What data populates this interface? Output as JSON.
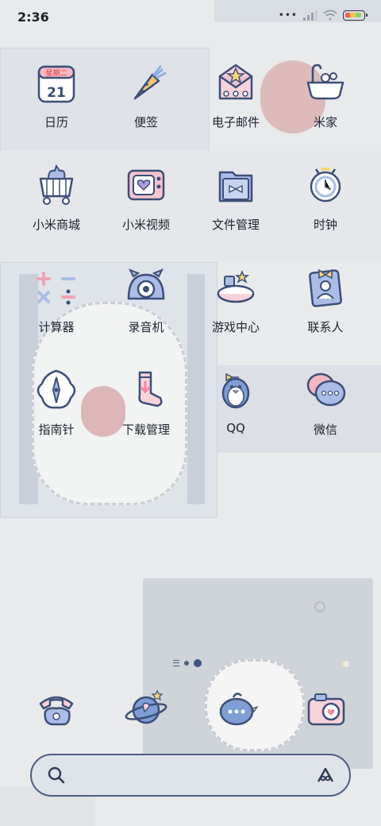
{
  "status_bar": {
    "time": "2:36"
  },
  "apps": [
    {
      "label": "日历",
      "icon": "calendar-icon"
    },
    {
      "label": "便签",
      "icon": "carrot-note-icon"
    },
    {
      "label": "电子邮件",
      "icon": "envelope-icon"
    },
    {
      "label": "米家",
      "icon": "bathtub-icon"
    },
    {
      "label": "小米商城",
      "icon": "shopping-cart-cat-icon"
    },
    {
      "label": "小米视频",
      "icon": "tv-heart-icon"
    },
    {
      "label": "文件管理",
      "icon": "folder-bow-icon"
    },
    {
      "label": "时钟",
      "icon": "alarm-clock-icon"
    },
    {
      "label": "计算器",
      "icon": "calculator-icon"
    },
    {
      "label": "录音机",
      "icon": "recorder-icon"
    },
    {
      "label": "游戏中心",
      "icon": "cake-game-icon"
    },
    {
      "label": "联系人",
      "icon": "contacts-icon"
    },
    {
      "label": "指南针",
      "icon": "compass-icon"
    },
    {
      "label": "下载管理",
      "icon": "sock-download-icon"
    },
    {
      "label": "QQ",
      "icon": "penguin-icon"
    },
    {
      "label": "微信",
      "icon": "chat-bubbles-icon"
    }
  ],
  "calendar_icon": {
    "weekday": "星期二",
    "day": "21"
  },
  "dock": [
    {
      "name": "phone",
      "icon": "telephone-icon"
    },
    {
      "name": "browser",
      "icon": "planet-icon"
    },
    {
      "name": "messages",
      "icon": "message-bird-icon"
    },
    {
      "name": "camera",
      "icon": "camera-icon"
    }
  ],
  "search": {
    "placeholder": ""
  },
  "pager": {
    "pages": 2,
    "active": 2
  },
  "colors": {
    "outline": "#3c4f78",
    "accent_blue": "#a9bde6",
    "accent_pink": "#f2b7c3",
    "accent_yellow": "#f8d77a"
  }
}
